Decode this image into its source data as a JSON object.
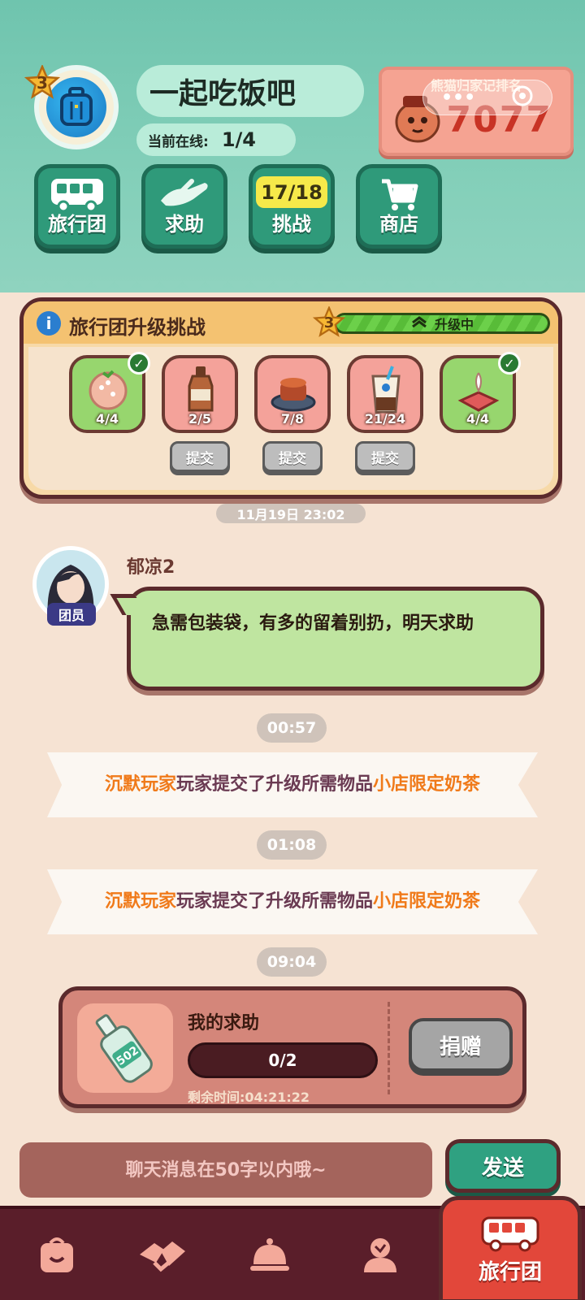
{
  "header": {
    "team_level": "3",
    "team_name": "一起吃饭吧",
    "online_label": "当前在线:",
    "online_value": "1/4",
    "rank_title": "熊猫归家记排名",
    "rank_value": "7077",
    "nav_buttons": [
      {
        "label": "旅行团",
        "icon": "bus-icon"
      },
      {
        "label": "求助",
        "icon": "helping-hand-icon"
      },
      {
        "label": "挑战",
        "icon": "challenge-icon",
        "badge": "17/18"
      },
      {
        "label": "商店",
        "icon": "cart-icon"
      }
    ]
  },
  "challenge": {
    "title": "旅行团升级挑战",
    "level": "3",
    "status": "升级中",
    "progress": 1.0,
    "items": [
      {
        "name": "rice-ball",
        "count": "4/4",
        "done": true
      },
      {
        "name": "sauce-bottle",
        "count": "2/5",
        "done": false,
        "submit": "提交"
      },
      {
        "name": "braised-dish",
        "count": "7/8",
        "done": false,
        "submit": "提交"
      },
      {
        "name": "milk-tea",
        "count": "21/24",
        "done": false,
        "submit": "提交"
      },
      {
        "name": "cake",
        "count": "4/4",
        "done": true
      }
    ]
  },
  "chat": {
    "partial_timestamp": "11月19日 23:02",
    "message": {
      "sender": "郁凉2",
      "role": "团员",
      "text": "急需包装袋，有多的留着别扔，明天求助"
    },
    "timestamps": [
      "00:57",
      "01:08",
      "09:04"
    ],
    "notices": [
      {
        "player": "沉默玩家",
        "middle": "玩家提交了升级所需物品",
        "item": "小店限定奶茶"
      },
      {
        "player": "沉默玩家",
        "middle": "玩家提交了升级所需物品",
        "item": "小店限定奶茶"
      }
    ]
  },
  "help_card": {
    "title": "我的求助",
    "item_label": "502",
    "progress": "0/2",
    "remaining": "剩余时间:04:21:22",
    "donate": "捐赠"
  },
  "input": {
    "placeholder": "聊天消息在50字以内哦~",
    "send": "发送"
  },
  "bottom_nav": {
    "tabs": [
      {
        "icon": "bag-icon"
      },
      {
        "icon": "handshake-icon"
      },
      {
        "icon": "service-bell-icon"
      },
      {
        "icon": "profile-icon"
      },
      {
        "icon": "bus-icon",
        "label": "旅行团",
        "active": true
      }
    ]
  },
  "colors": {
    "header_bg": "#83cfb9",
    "accent_green": "#2f9a7a",
    "dark_outline": "#5b2a2c",
    "notice_orange": "#f07a1a",
    "active_tab": "#e2473a"
  }
}
